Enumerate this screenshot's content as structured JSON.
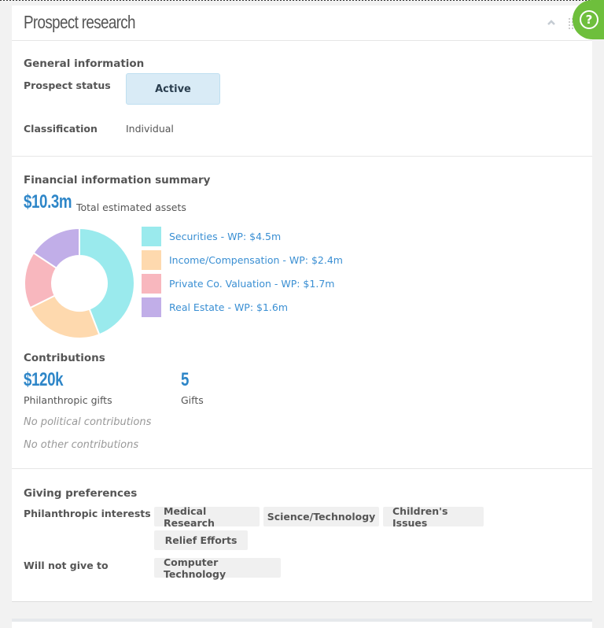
{
  "card": {
    "title": "Prospect research",
    "help_label": "?"
  },
  "general": {
    "title": "General information",
    "prospect_status_label": "Prospect status",
    "prospect_status_value": "Active",
    "classification_label": "Classification",
    "classification_value": "Individual"
  },
  "financial": {
    "title": "Financial information summary",
    "total_value": "$10.3m",
    "total_label": "Total estimated assets",
    "legend": [
      {
        "label": "Securities - WP: $4.5m",
        "value": 4.5,
        "color": "#9aeaed"
      },
      {
        "label": "Income/Compensation - WP: $2.4m",
        "value": 2.4,
        "color": "#fed9ae"
      },
      {
        "label": "Private Co. Valuation - WP: $1.7m",
        "value": 1.7,
        "color": "#f8b7be"
      },
      {
        "label": "Real Estate - WP: $1.6m",
        "value": 1.6,
        "color": "#c1aee8"
      }
    ]
  },
  "contributions": {
    "title": "Contributions",
    "philanthropic_value": "$120k",
    "philanthropic_label": "Philanthropic gifts",
    "gifts_value": "5",
    "gifts_label": "Gifts",
    "political": "No political contributions",
    "other": "No other contributions"
  },
  "giving": {
    "title": "Giving preferences",
    "interests_label": "Philanthropic interests",
    "interests": [
      "Medical Research",
      "Science/Technology",
      "Children's Issues",
      "Relief Efforts"
    ],
    "will_not_label": "Will not give to",
    "will_not": [
      "Computer Technology"
    ]
  },
  "chart_data": {
    "type": "pie",
    "title": "Total estimated assets",
    "categories": [
      "Securities",
      "Income/Compensation",
      "Private Co. Valuation",
      "Real Estate"
    ],
    "values": [
      4.5,
      2.4,
      1.7,
      1.6
    ],
    "units": "$m",
    "donut": true,
    "legend": "right"
  }
}
